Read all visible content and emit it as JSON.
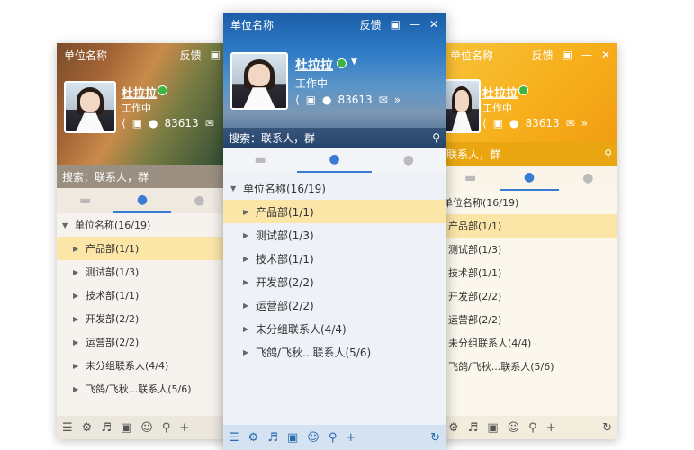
{
  "windows": [
    {
      "id": "left",
      "title": "单位名称",
      "feedback": "反馈",
      "user": "杜拉拉",
      "status": "工作中",
      "count": "83613",
      "search_placeholder": "搜索：联系人，群",
      "root": "单位名称(16/19)",
      "groups": [
        "产品部(1/1)",
        "测试部(1/3)",
        "技术部(1/1)",
        "开发部(2/2)",
        "运营部(2/2)",
        "未分组联系人(4/4)",
        "飞鸽/飞秋...联系人(5/6)"
      ]
    },
    {
      "id": "center",
      "title": "单位名称",
      "feedback": "反馈",
      "user": "杜拉拉",
      "status": "工作中",
      "count": "83613",
      "search_placeholder": "搜索：联系人，群",
      "root": "单位名称(16/19)",
      "groups": [
        "产品部(1/1)",
        "测试部(1/3)",
        "技术部(1/1)",
        "开发部(2/2)",
        "运营部(2/2)",
        "未分组联系人(4/4)",
        "飞鸽/飞秋...联系人(5/6)"
      ]
    },
    {
      "id": "right",
      "title": "单位名称",
      "feedback": "反馈",
      "user": "杜拉拉",
      "status": "工作中",
      "count": "83613",
      "search_placeholder": "联系人，群",
      "root": "单位名称(16/19)",
      "groups": [
        "产品部(1/1)",
        "测试部(1/3)",
        "技术部(1/1)",
        "开发部(2/2)",
        "运营部(2/2)",
        "未分组联系人(4/4)",
        "飞鸽/飞秋...联系人(5/6)"
      ]
    }
  ],
  "icons": {
    "close": "✕",
    "minimize": "—",
    "skin": "shirt-icon",
    "share": "share-icon",
    "chat": "chat-icon",
    "pig": "piggy-icon",
    "mail": "mail-icon",
    "more": "»",
    "search": "search-icon"
  }
}
